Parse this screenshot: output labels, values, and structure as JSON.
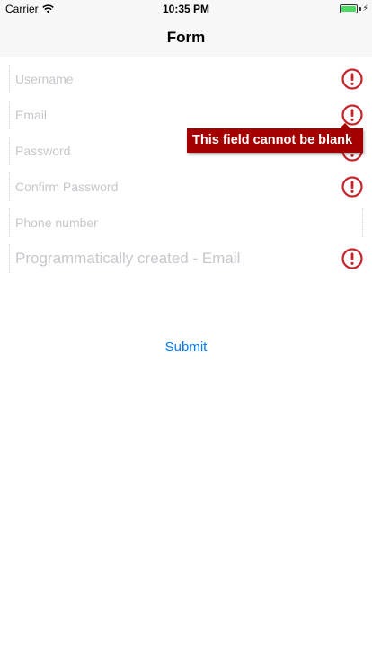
{
  "status_bar": {
    "carrier": "Carrier",
    "time": "10:35 PM",
    "wifi_icon": "wifi-icon",
    "battery_icon": "battery-charging-icon"
  },
  "nav": {
    "title": "Form"
  },
  "form": {
    "fields": [
      {
        "placeholder": "Username",
        "value": "",
        "error": true
      },
      {
        "placeholder": "Email",
        "value": "",
        "error": true
      },
      {
        "placeholder": "Password",
        "value": "",
        "error": true
      },
      {
        "placeholder": "Confirm Password",
        "value": "",
        "error": true
      },
      {
        "placeholder": "Phone number",
        "value": "",
        "error": false
      },
      {
        "placeholder": "Programmatically created - Email",
        "value": "",
        "error": true
      }
    ],
    "error_icon": "exclamation-circle-icon",
    "error_color": "#c9222a",
    "tooltip": "This field cannot be blank",
    "tooltip_color": "#a50000",
    "submit_label": "Submit",
    "accent_color": "#007aff"
  }
}
